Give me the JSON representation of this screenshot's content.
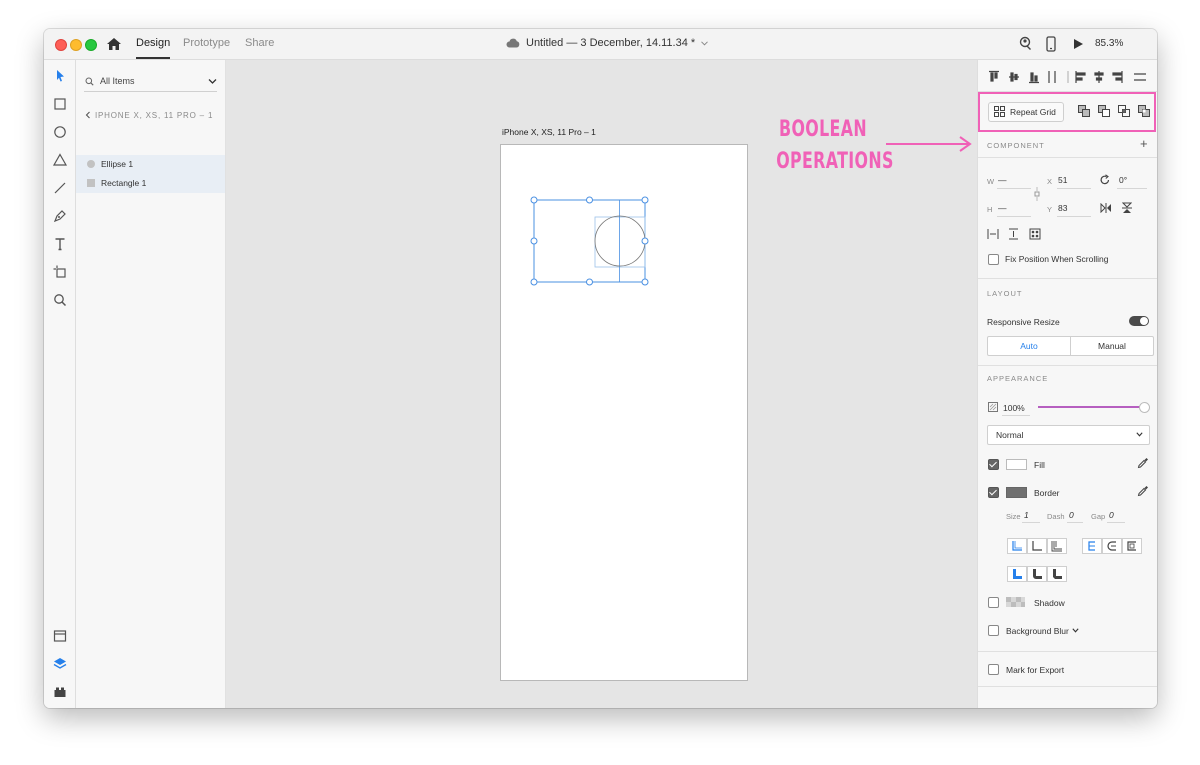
{
  "titlebar": {
    "tabs": [
      {
        "label": "Design",
        "active": true
      },
      {
        "label": "Prototype",
        "active": false
      },
      {
        "label": "Share",
        "active": false
      }
    ],
    "document_title": "Untitled — 3 December, 14.11.34 *",
    "zoom": "85.3%"
  },
  "layers": {
    "search_label": "All Items",
    "artboard_name": "IPHONE X, XS, 11 PRO – 1",
    "items": [
      {
        "name": "Ellipse 1",
        "shape": "ellipse"
      },
      {
        "name": "Rectangle 1",
        "shape": "rectangle"
      }
    ]
  },
  "canvas": {
    "artboard_title": "iPhone X, XS, 11 Pro – 1",
    "annotation_line1": "BOOLEAN",
    "annotation_line2": "OPERATIONS",
    "annotation_color": "#f061b7"
  },
  "props": {
    "repeat_grid_label": "Repeat Grid",
    "component_title": "COMPONENT",
    "w_label": "W",
    "w_value": "—",
    "h_label": "H",
    "h_value": "—",
    "x_label": "X",
    "x_value": "51",
    "y_label": "Y",
    "y_value": "83",
    "rotation": "0°",
    "fix_position_label": "Fix Position When Scrolling",
    "layout_title": "LAYOUT",
    "responsive_resize_label": "Responsive Resize",
    "responsive_on": true,
    "auto_label": "Auto",
    "manual_label": "Manual",
    "appearance_title": "APPEARANCE",
    "opacity": "100%",
    "blend_mode": "Normal",
    "fill_label": "Fill",
    "fill_checked": true,
    "fill_color": "#ffffff",
    "border_label": "Border",
    "border_checked": true,
    "border_color": "#707070",
    "size_label": "Size",
    "size_value": "1",
    "dash_label": "Dash",
    "dash_value": "0",
    "gap_label": "Gap",
    "gap_value": "0",
    "shadow_label": "Shadow",
    "background_blur_label": "Background Blur",
    "mark_export_label": "Mark for Export",
    "accent_color": "#2680eb"
  }
}
